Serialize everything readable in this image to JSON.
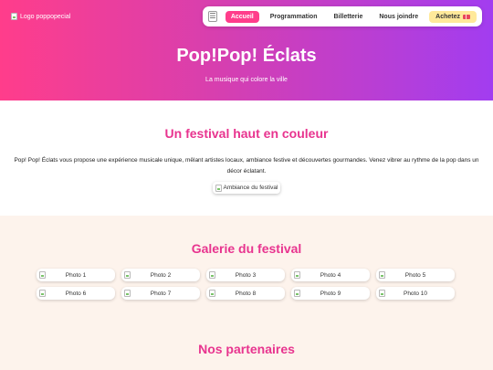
{
  "header": {
    "logo_alt": "Logo poppopecial",
    "nav": {
      "toggle_glyph": "☰",
      "items": [
        "Accueil",
        "Programmation",
        "Billetterie",
        "Nous joindre"
      ],
      "active_index": 0,
      "cta_label": "Achetez",
      "cta_icon": "ticket-icon"
    }
  },
  "hero": {
    "title": "Pop!Pop! Éclats",
    "subtitle": "La musique qui colore la ville",
    "gradient": [
      "#ff3d8b",
      "#a23df0"
    ]
  },
  "intro": {
    "title": "Un festival haut en couleur",
    "text": "Pop! Pop! Éclats vous propose une expérience musicale unique, mêlant artistes locaux, ambiance festive et découvertes gourmandes. Venez vibrer au rythme de la pop dans un décor éclatant.",
    "image_alt": "Ambiance du festival"
  },
  "gallery": {
    "title": "Galerie du festival",
    "photos": [
      "Photo 1",
      "Photo 2",
      "Photo 3",
      "Photo 4",
      "Photo 5",
      "Photo 6",
      "Photo 7",
      "Photo 8",
      "Photo 9",
      "Photo 10"
    ]
  },
  "partners": {
    "title": "Nos partenaires"
  },
  "colors": {
    "accent": "#e8348f",
    "nav_active": "#ff3d8b",
    "cta_bg": "#ffe99a",
    "gallery_bg": "#fdf3ec"
  }
}
